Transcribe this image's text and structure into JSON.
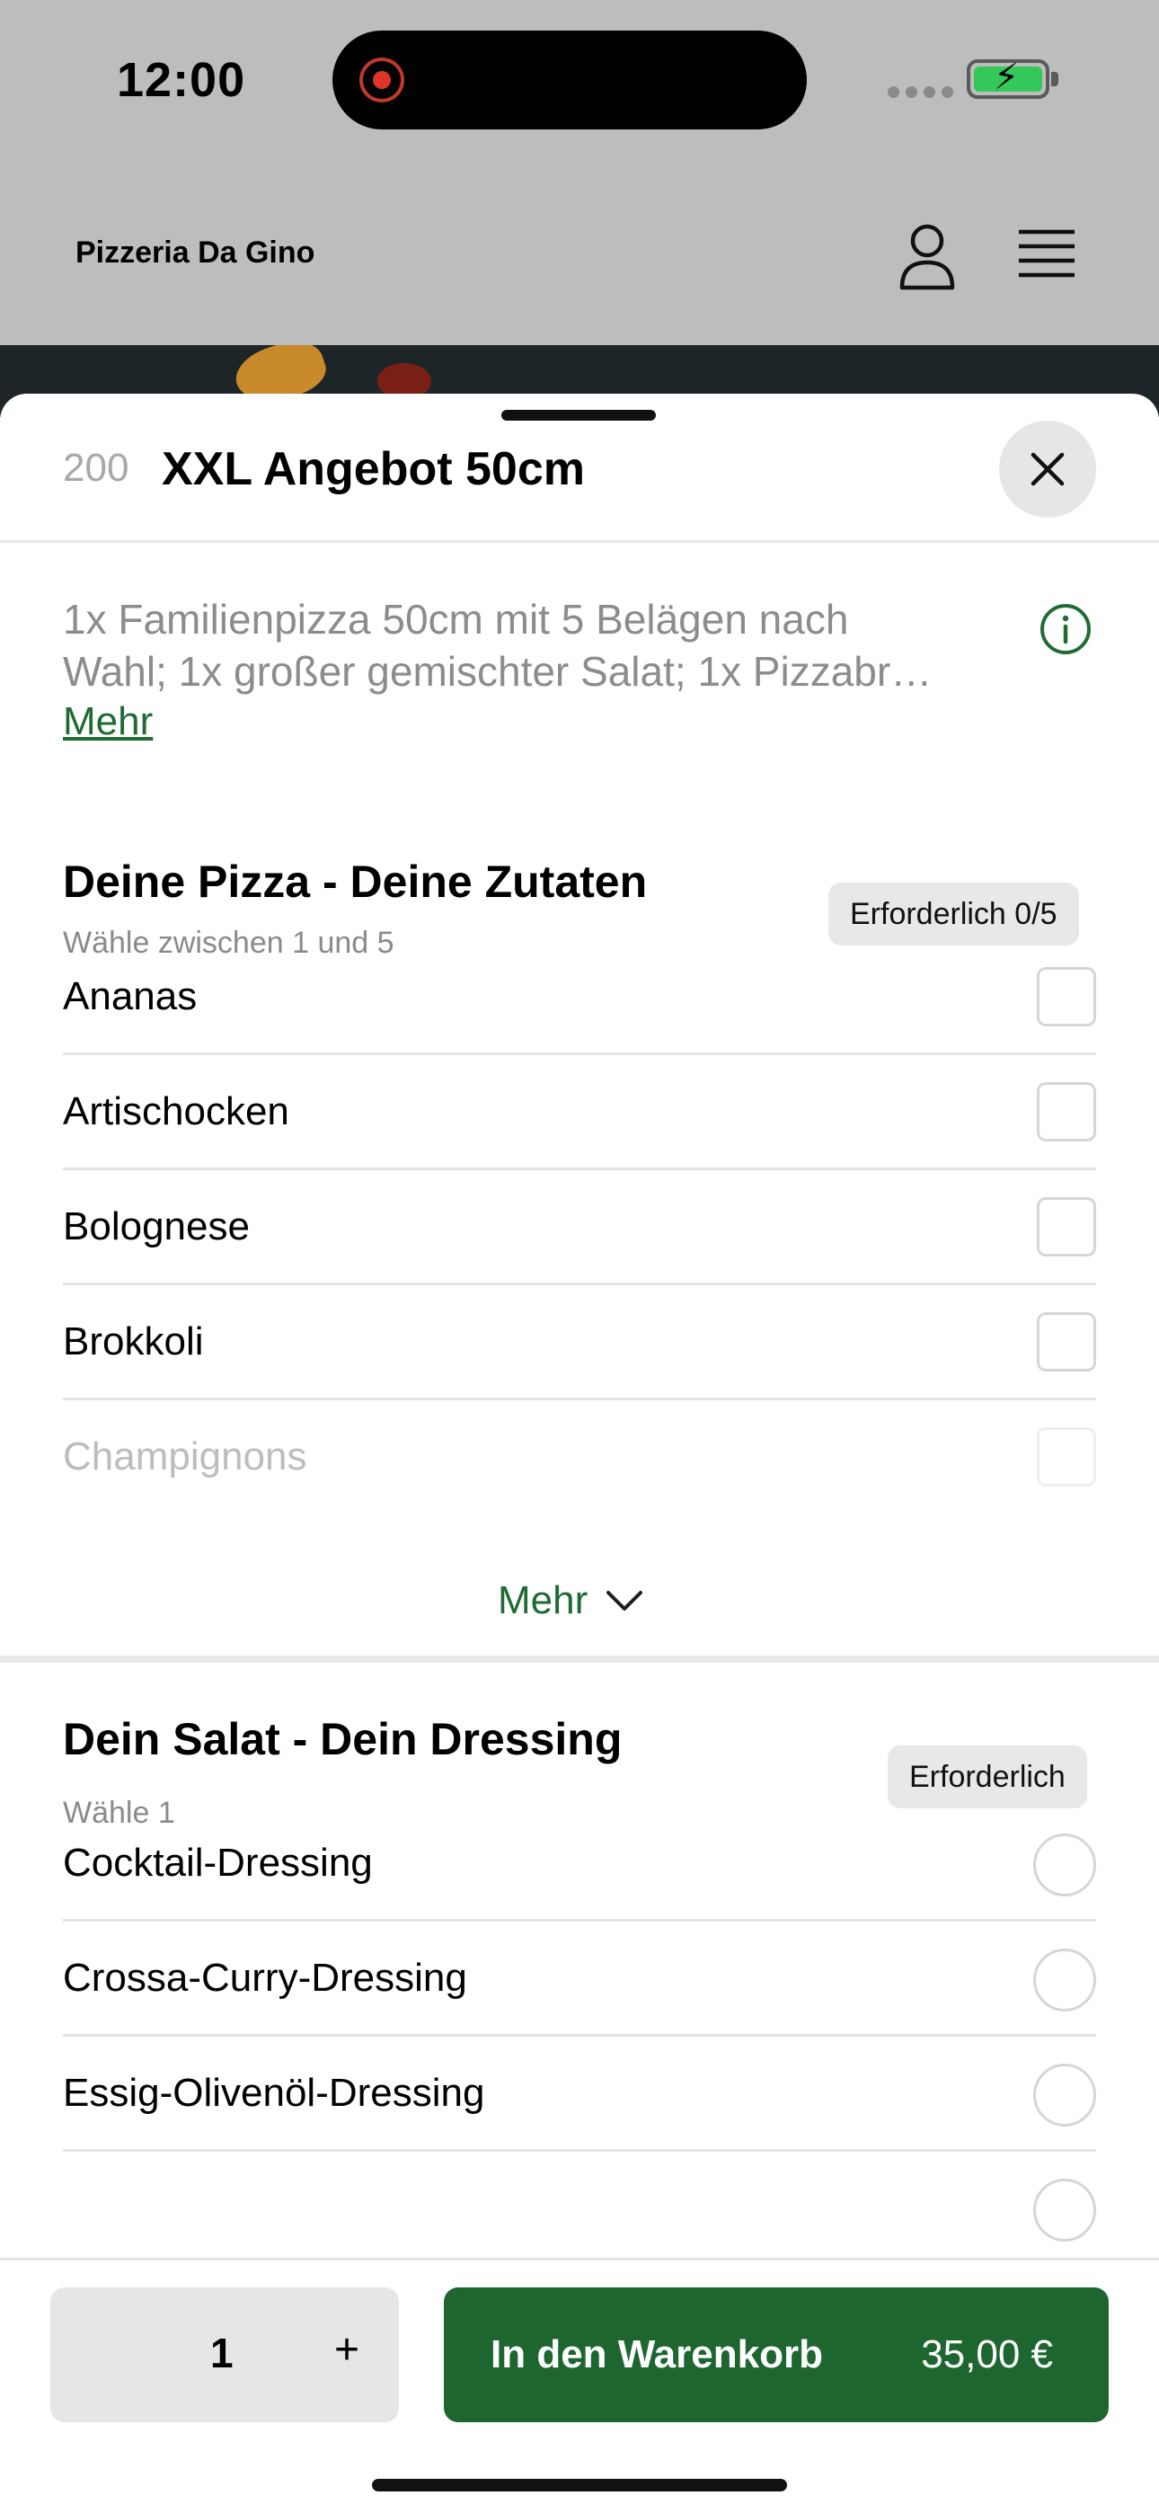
{
  "status_bar": {
    "time": "12:00"
  },
  "header": {
    "restaurant_name": "Pizzeria Da Gino"
  },
  "product": {
    "number": "200",
    "title": "XXL Angebot 50cm",
    "description": "1x Familienpizza 50cm mit 5 Belägen nach Wahl; 1x großer gemischter Salat; 1x Pizzabr…",
    "description_line1": "1x Familienpizza 50cm mit 5 Belägen nach",
    "description_line2": "Wahl; 1x großer gemischter Salat; 1x Pizzabr…",
    "more_link": "Mehr"
  },
  "groups": [
    {
      "title": "Deine Pizza - Deine Zutaten",
      "subtitle": "Wähle zwischen 1 und 5",
      "badge": "Erforderlich 0/5",
      "options": [
        "Ananas",
        "Artischocken",
        "Bolognese",
        "Brokkoli",
        "Champignons"
      ],
      "show_more": "Mehr"
    },
    {
      "title": "Dein Salat - Dein Dressing",
      "subtitle": "Wähle 1",
      "badge": "Erforderlich",
      "options": [
        "Cocktail-Dressing",
        "Crossa-Curry-Dressing",
        "Essig-Olivenöl-Dressing"
      ]
    }
  ],
  "cart": {
    "quantity": "1",
    "plus": "+",
    "button_label": "In den Warenkorb",
    "price": "35,00 €"
  },
  "colors": {
    "accent": "#1e6630",
    "badge_bg": "#e8e8e8",
    "overlay": "#bdbdbd"
  }
}
